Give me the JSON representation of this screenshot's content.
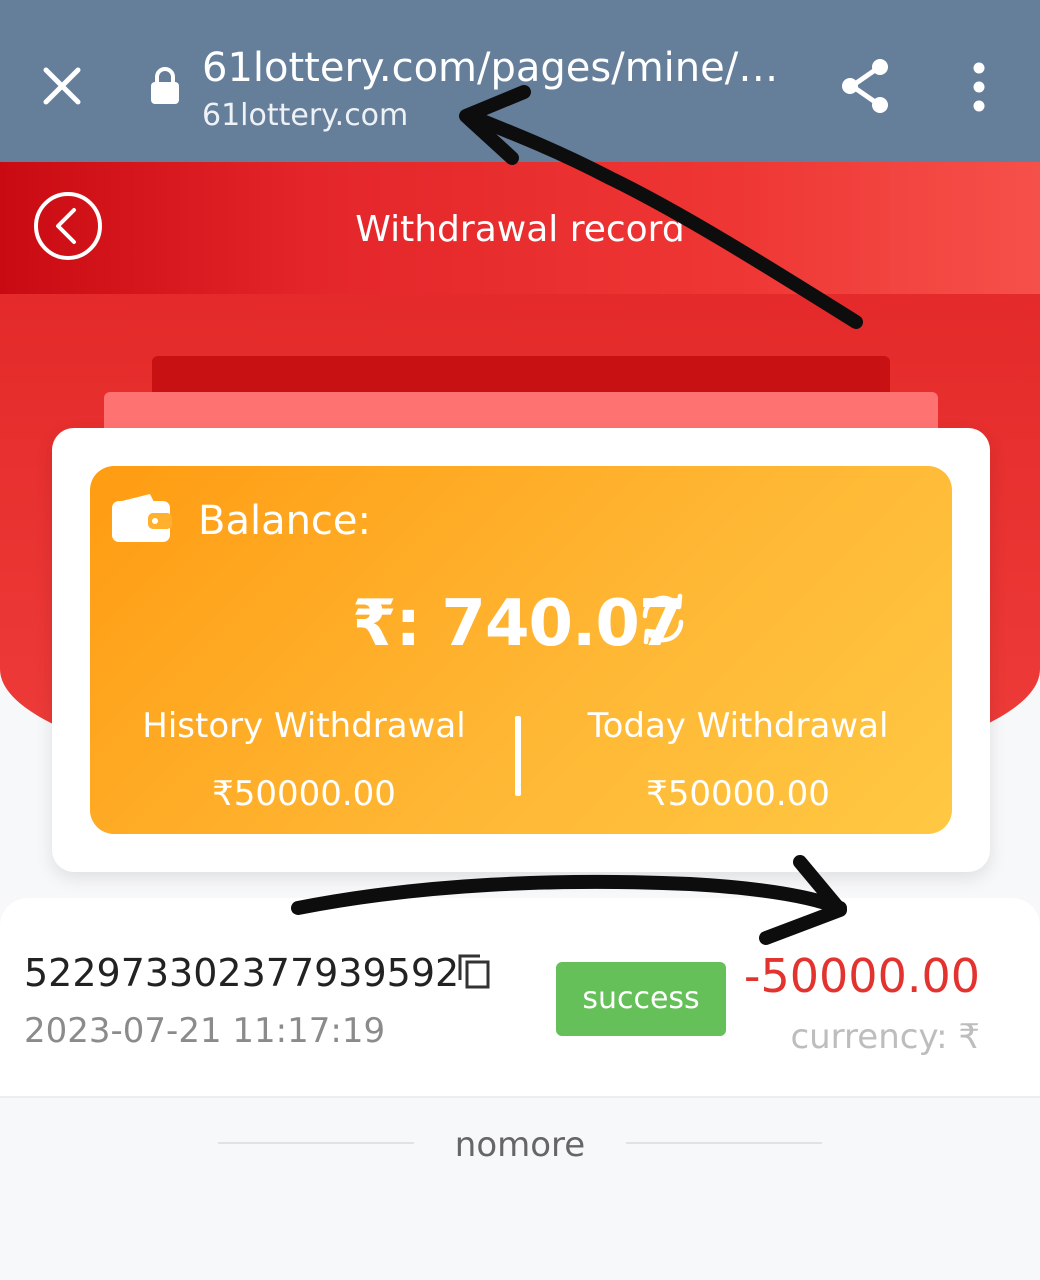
{
  "browser": {
    "url": "61lottery.com/pages/mine/i...",
    "domain": "61lottery.com",
    "icons": [
      "close-icon",
      "lock-icon",
      "share-icon",
      "more-vert-icon"
    ]
  },
  "header": {
    "title": "Withdrawal record",
    "back_icon": "chevron-left-circle-icon",
    "colors": {
      "primary_red": "#e4262a",
      "browser_bar": "#657f9b"
    }
  },
  "balance": {
    "label": "Balance:",
    "amount": "₹: 740.07",
    "history_label": "History Withdrawal",
    "history_value": "₹50000.00",
    "today_label": "Today Withdrawal",
    "today_value": "₹50000.00",
    "card_color": "#ffb633"
  },
  "records": [
    {
      "order_id": "5229733023779395​92",
      "time": "2023-07-21 11:17:19",
      "status": "success",
      "amount": "-50000.00",
      "currency": "currency: ₹"
    }
  ],
  "footer": {
    "nomore": "nomore"
  }
}
